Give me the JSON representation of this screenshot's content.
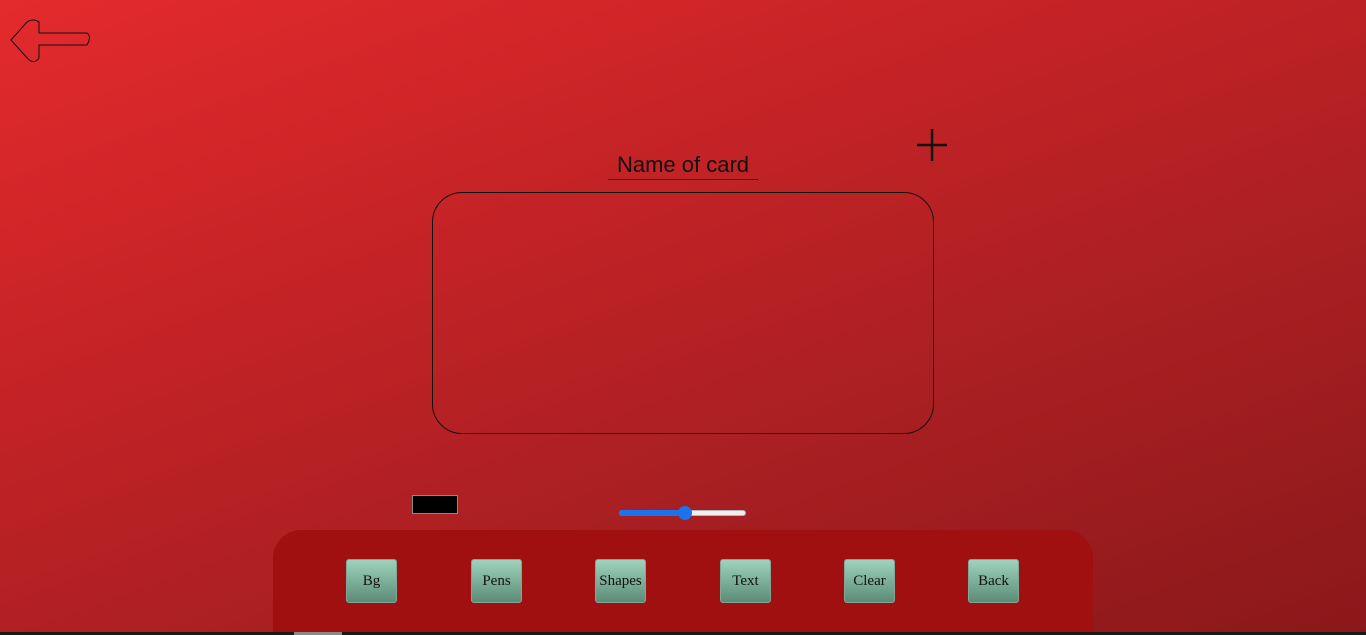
{
  "header": {
    "card_name_placeholder": "Name of card"
  },
  "controls": {
    "pen_color": "#000000",
    "size_slider_value": 0.52,
    "slider_accent": "#1a73e8"
  },
  "toolbar": {
    "buttons": [
      {
        "label": "Bg"
      },
      {
        "label": "Pens"
      },
      {
        "label": "Shapes"
      },
      {
        "label": "Text"
      },
      {
        "label": "Clear"
      },
      {
        "label": "Back"
      }
    ]
  },
  "icons": {
    "back": "back-arrow-icon",
    "add": "plus-icon"
  },
  "colors": {
    "background_start": "#e42a2d",
    "background_end": "#8a181a",
    "toolbar_bg": "#a01010",
    "button_top": "#9dd3bd",
    "button_bottom": "#5c8c78"
  }
}
